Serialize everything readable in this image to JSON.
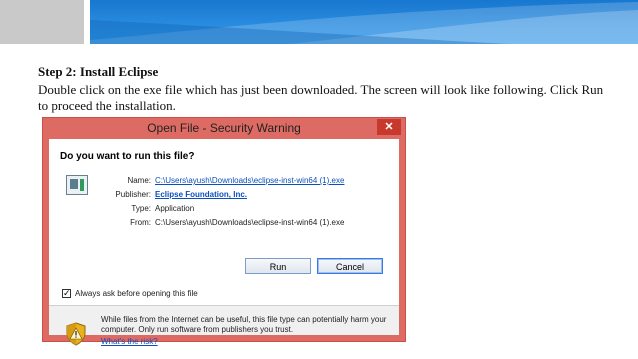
{
  "slide": {
    "step_title": "Step 2: Install Eclipse",
    "step_description": "Double click on the exe file which has just been downloaded. The screen will look like following. Click Run to proceed the installation."
  },
  "dialog": {
    "title": "Open File - Security Warning",
    "close_glyph": "✕",
    "question": "Do you want to run this file?",
    "fields": {
      "name_label": "Name:",
      "name_value": "C:\\Users\\ayush\\Downloads\\eclipse-inst-win64 (1).exe",
      "publisher_label": "Publisher:",
      "publisher_value": "Eclipse Foundation, Inc.",
      "type_label": "Type:",
      "type_value": "Application",
      "from_label": "From:",
      "from_value": "C:\\Users\\ayush\\Downloads\\eclipse-inst-win64 (1).exe"
    },
    "run_button": "Run",
    "cancel_button": "Cancel",
    "checkbox_label": "Always ask before opening this file",
    "checkbox_checked": true,
    "checkbox_glyph": "✓",
    "warning_text": "While files from the Internet can be useful, this file type can potentially harm your computer. Only run software from publishers you trust.",
    "risk_link": "What's the risk?"
  },
  "colors": {
    "titlebar": "#dd6b64",
    "header_blue": "#1877cf",
    "link": "#0b4fbf"
  },
  "icons": [
    "file-exe-icon",
    "shield-warning-icon",
    "close-icon",
    "checkmark-icon"
  ]
}
